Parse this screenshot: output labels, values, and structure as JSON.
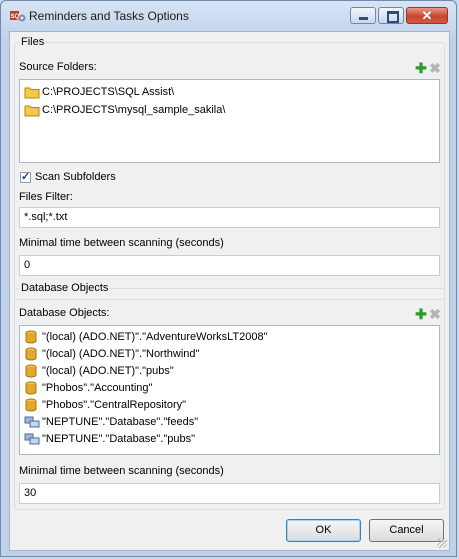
{
  "window": {
    "title": "Reminders and Tasks Options"
  },
  "files_group": {
    "title": "Files",
    "source_folders_label": "Source Folders:",
    "folders": [
      "C:\\PROJECTS\\SQL Assist\\",
      "C:\\PROJECTS\\mysql_sample_sakila\\"
    ],
    "scan_subfolders_label": "Scan Subfolders",
    "scan_subfolders_checked": true,
    "files_filter_label": "Files Filter:",
    "files_filter_value": "*.sql;*.txt",
    "min_time_label": "Minimal time between scanning (seconds)",
    "min_time_value": "0"
  },
  "db_group": {
    "title": "Database Objects",
    "objects_label": "Database Objects:",
    "objects": [
      {
        "text": "\"(local) (ADO.NET)\".\"AdventureWorksLT2008\"",
        "icon": "database-icon"
      },
      {
        "text": "\"(local) (ADO.NET)\".\"Northwind\"",
        "icon": "database-icon"
      },
      {
        "text": "\"(local) (ADO.NET)\".\"pubs\"",
        "icon": "database-icon"
      },
      {
        "text": "\"Phobos\".\"Accounting\"",
        "icon": "database-icon"
      },
      {
        "text": "\"Phobos\".\"CentralRepository\"",
        "icon": "database-icon"
      },
      {
        "text": "\"NEPTUNE\".\"Database\".\"feeds\"",
        "icon": "server-icon"
      },
      {
        "text": "\"NEPTUNE\".\"Database\".\"pubs\"",
        "icon": "server-icon"
      }
    ],
    "min_time_label": "Minimal time between scanning (seconds)",
    "min_time_value": "30"
  },
  "buttons": {
    "ok": "OK",
    "cancel": "Cancel"
  },
  "toolbar": {
    "add_glyph": "✚",
    "remove_glyph": "✖"
  },
  "colors": {
    "add": "#2e9b2e",
    "remove_disabled": "#b5b5b5",
    "folder": "#f2c94c",
    "database": "#e0a92a"
  }
}
